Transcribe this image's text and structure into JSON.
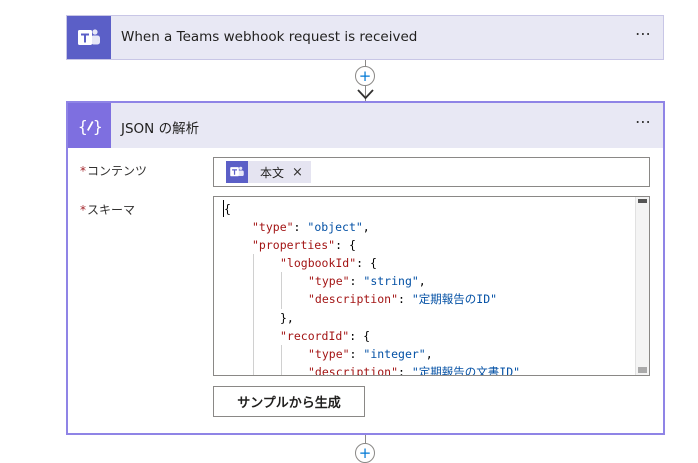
{
  "trigger": {
    "title": "When a Teams webhook request is received",
    "more_label": "⋯",
    "icon": "teams-icon"
  },
  "connector": {
    "add_label": "+"
  },
  "parse_json": {
    "title": "JSON の解析",
    "more_label": "⋯",
    "icon": "curly-braces-icon",
    "accent": "#7e6fe0",
    "content_field": {
      "required_mark": "*",
      "label": "コンテンツ",
      "token_label": "本文",
      "remove_label": "×"
    },
    "schema_field": {
      "required_mark": "*",
      "label": "スキーマ",
      "lines": [
        {
          "indent": 0,
          "parts": [
            {
              "t": "p",
              "v": "{"
            }
          ]
        },
        {
          "indent": 1,
          "parts": [
            {
              "t": "k",
              "v": "\"type\""
            },
            {
              "t": "p",
              "v": ": "
            },
            {
              "t": "s",
              "v": "\"object\""
            },
            {
              "t": "p",
              "v": ","
            }
          ]
        },
        {
          "indent": 1,
          "parts": [
            {
              "t": "k",
              "v": "\"properties\""
            },
            {
              "t": "p",
              "v": ": {"
            }
          ]
        },
        {
          "indent": 2,
          "parts": [
            {
              "t": "k",
              "v": "\"logbookId\""
            },
            {
              "t": "p",
              "v": ": {"
            }
          ]
        },
        {
          "indent": 3,
          "parts": [
            {
              "t": "k",
              "v": "\"type\""
            },
            {
              "t": "p",
              "v": ": "
            },
            {
              "t": "s",
              "v": "\"string\""
            },
            {
              "t": "p",
              "v": ","
            }
          ]
        },
        {
          "indent": 3,
          "parts": [
            {
              "t": "k",
              "v": "\"description\""
            },
            {
              "t": "p",
              "v": ": "
            },
            {
              "t": "s",
              "v": "\"定期報告のID\""
            }
          ]
        },
        {
          "indent": 2,
          "parts": [
            {
              "t": "p",
              "v": "},"
            }
          ]
        },
        {
          "indent": 2,
          "parts": [
            {
              "t": "k",
              "v": "\"recordId\""
            },
            {
              "t": "p",
              "v": ": {"
            }
          ]
        },
        {
          "indent": 3,
          "parts": [
            {
              "t": "k",
              "v": "\"type\""
            },
            {
              "t": "p",
              "v": ": "
            },
            {
              "t": "s",
              "v": "\"integer\""
            },
            {
              "t": "p",
              "v": ","
            }
          ]
        },
        {
          "indent": 3,
          "parts": [
            {
              "t": "k",
              "v": "\"description\""
            },
            {
              "t": "p",
              "v": ": "
            },
            {
              "t": "s",
              "v": "\"定期報告の文書ID\""
            }
          ]
        }
      ]
    },
    "generate_button": "サンプルから生成"
  }
}
